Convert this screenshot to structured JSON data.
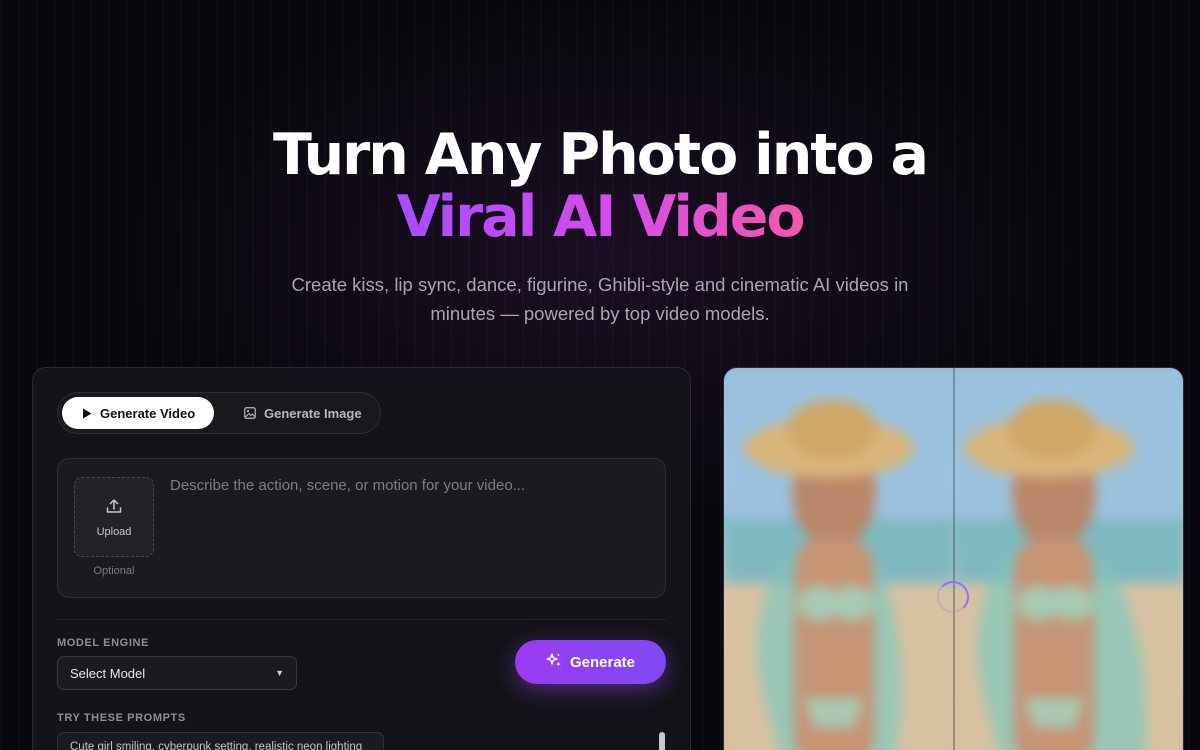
{
  "hero": {
    "title_line1": "Turn Any Photo into a",
    "title_line2": "Viral AI Video",
    "subtitle": "Create kiss, lip sync, dance, figurine, Ghibli-style and cinematic AI videos in minutes — powered by top video models."
  },
  "tabs": [
    {
      "label": "Generate Video",
      "icon": "play-icon",
      "active": true
    },
    {
      "label": "Generate Image",
      "icon": "image-icon",
      "active": false
    }
  ],
  "prompt": {
    "placeholder": "Describe the action, scene, or motion for your video...",
    "upload_label": "Upload",
    "upload_hint": "Optional"
  },
  "model": {
    "label": "MODEL ENGINE",
    "selected": "Select Model"
  },
  "generate_label": "Generate",
  "prompts_section": {
    "label": "TRY THESE PROMPTS",
    "items": [
      "Cute girl smiling, cyberpunk setting, realistic neon lighting"
    ]
  },
  "colors": {
    "accent_start": "#a64dff",
    "accent_end": "#f05aa8",
    "button": "#8a42f1"
  }
}
